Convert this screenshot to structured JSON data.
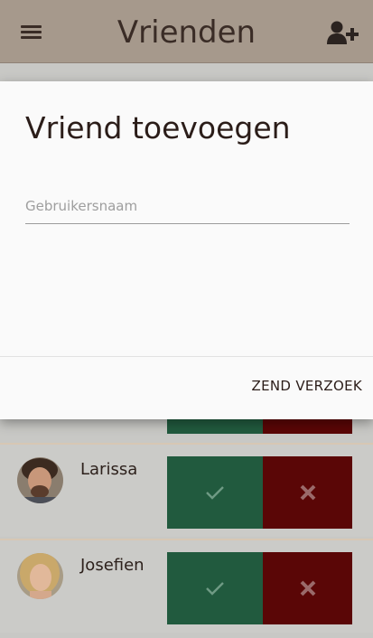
{
  "header": {
    "title": "Vrienden"
  },
  "dialog": {
    "title": "Vriend toevoegen",
    "username_placeholder": "Gebruikersnaam",
    "username_value": "",
    "send_label": "ZEND VERZOEK"
  },
  "friends": [
    {
      "name": "Larissa"
    },
    {
      "name": "Josefien"
    }
  ],
  "colors": {
    "topbar": "#a6998c",
    "accept": "#215a3e",
    "reject": "#5a0606",
    "dialog_bg": "#fafafa"
  }
}
